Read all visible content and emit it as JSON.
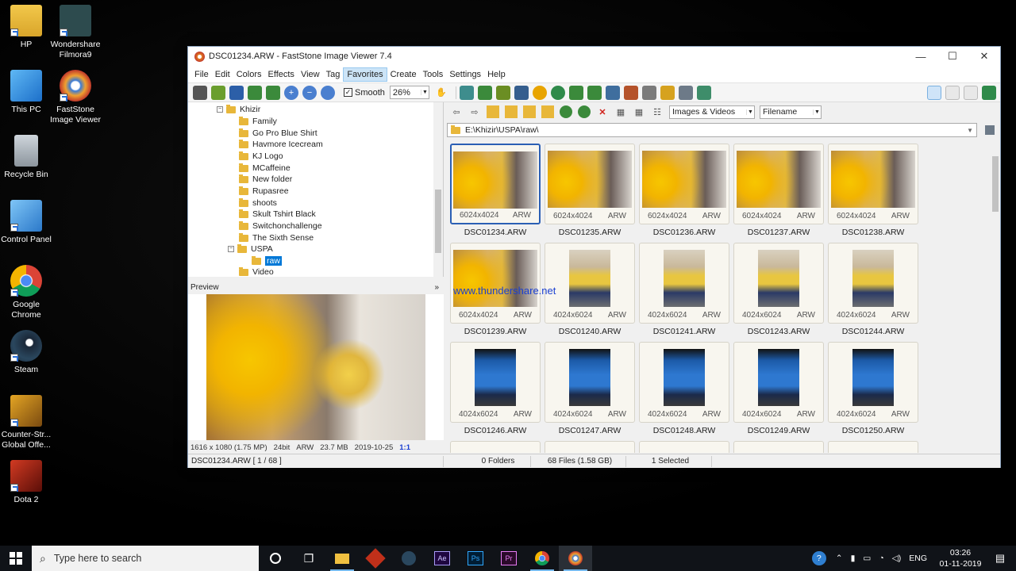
{
  "desktop": {
    "icons": [
      {
        "label": "HP"
      },
      {
        "label": "Wondershare Filmora9"
      },
      {
        "label": "This PC"
      },
      {
        "label": "FastStone Image Viewer"
      },
      {
        "label": "Recycle Bin"
      },
      {
        "label": "Control Panel"
      },
      {
        "label": "Google Chrome"
      },
      {
        "label": "Steam"
      },
      {
        "label": "Counter-Str... Global Offe..."
      },
      {
        "label": "Dota 2"
      }
    ]
  },
  "window": {
    "title": "DSC01234.ARW  -  FastStone Image Viewer 7.4",
    "minimize": "—",
    "maximize": "☐",
    "close": "✕"
  },
  "menu": [
    "File",
    "Edit",
    "Colors",
    "Effects",
    "View",
    "Tag",
    "Favorites",
    "Create",
    "Tools",
    "Settings",
    "Help"
  ],
  "toolbar": {
    "smooth_label": "Smooth",
    "smooth_checked": "✓",
    "zoom_value": "26%"
  },
  "tree": {
    "root": "Khizir",
    "items": [
      "Family",
      "Go Pro Blue Shirt",
      "Havmore Icecream",
      "KJ Logo",
      "MCaffeine",
      "New folder",
      "Rupasree",
      "shoots",
      "Skult Tshirt Black",
      "Switchonchallenge",
      "The Sixth Sense",
      "USPA",
      "raw",
      "Video"
    ]
  },
  "preview": {
    "title": "Preview",
    "resolution": "1616 x 1080 (1.75 MP)",
    "bits": "24bit",
    "format": "ARW",
    "size": "23.7 MB",
    "date": "2019-10-25",
    "ratio": "1:1"
  },
  "browser": {
    "filter": "Images & Videos",
    "sort": "Filename",
    "path": "E:\\Khizir\\USPA\\raw\\",
    "watermark": "www.thundershare.net",
    "thumbnails": [
      {
        "name": "DSC01234.ARW",
        "dims": "6024x4024",
        "fmt": "ARW"
      },
      {
        "name": "DSC01235.ARW",
        "dims": "6024x4024",
        "fmt": "ARW"
      },
      {
        "name": "DSC01236.ARW",
        "dims": "6024x4024",
        "fmt": "ARW"
      },
      {
        "name": "DSC01237.ARW",
        "dims": "6024x4024",
        "fmt": "ARW"
      },
      {
        "name": "DSC01238.ARW",
        "dims": "6024x4024",
        "fmt": "ARW"
      },
      {
        "name": "DSC01239.ARW",
        "dims": "6024x4024",
        "fmt": "ARW"
      },
      {
        "name": "DSC01240.ARW",
        "dims": "4024x6024",
        "fmt": "ARW"
      },
      {
        "name": "DSC01241.ARW",
        "dims": "4024x6024",
        "fmt": "ARW"
      },
      {
        "name": "DSC01243.ARW",
        "dims": "4024x6024",
        "fmt": "ARW"
      },
      {
        "name": "DSC01244.ARW",
        "dims": "4024x6024",
        "fmt": "ARW"
      },
      {
        "name": "DSC01246.ARW",
        "dims": "4024x6024",
        "fmt": "ARW"
      },
      {
        "name": "DSC01247.ARW",
        "dims": "4024x6024",
        "fmt": "ARW"
      },
      {
        "name": "DSC01248.ARW",
        "dims": "4024x6024",
        "fmt": "ARW"
      },
      {
        "name": "DSC01249.ARW",
        "dims": "4024x6024",
        "fmt": "ARW"
      },
      {
        "name": "DSC01250.ARW",
        "dims": "4024x6024",
        "fmt": "ARW"
      }
    ]
  },
  "status": {
    "current": "DSC01234.ARW [ 1 / 68 ]",
    "folders": "0 Folders",
    "files": "68 Files (1.58 GB)",
    "selected": "1 Selected"
  },
  "taskbar": {
    "search_placeholder": "Type here to search",
    "lang": "ENG",
    "time": "03:26",
    "date": "01-11-2019",
    "apps": [
      "cortana-icon",
      "task-view-icon",
      "file-explorer-icon",
      "game-icon",
      "steam-icon",
      "after-effects-icon",
      "photoshop-icon",
      "premiere-icon",
      "chrome-icon",
      "faststone-icon"
    ]
  },
  "colors": {
    "selection": "#0078d7",
    "thumb_border_selected": "#2b5fb4",
    "watermark": "#1a3fd1"
  }
}
